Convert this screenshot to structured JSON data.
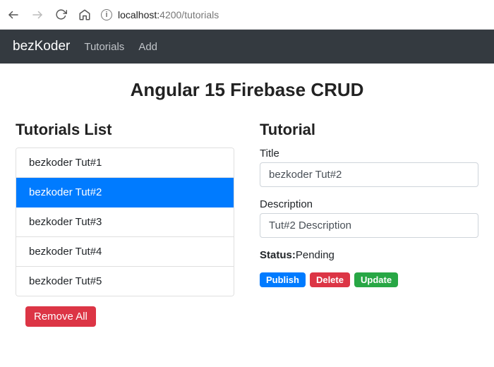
{
  "browser": {
    "host": "localhost:",
    "port_and_path": "4200/tutorials"
  },
  "nav": {
    "brand": "bezKoder",
    "links": [
      "Tutorials",
      "Add"
    ]
  },
  "page": {
    "title": "Angular 15 Firebase CRUD"
  },
  "list": {
    "heading": "Tutorials List",
    "items": [
      {
        "label": "bezkoder Tut#1",
        "active": false
      },
      {
        "label": "bezkoder Tut#2",
        "active": true
      },
      {
        "label": "bezkoder Tut#3",
        "active": false
      },
      {
        "label": "bezkoder Tut#4",
        "active": false
      },
      {
        "label": "bezkoder Tut#5",
        "active": false
      }
    ],
    "remove_all": "Remove All"
  },
  "detail": {
    "heading": "Tutorial",
    "title_label": "Title",
    "title_value": "bezkoder Tut#2",
    "desc_label": "Description",
    "desc_value": "Tut#2 Description",
    "status_label": "Status:",
    "status_value": "Pending",
    "publish": "Publish",
    "delete": "Delete",
    "update": "Update"
  }
}
